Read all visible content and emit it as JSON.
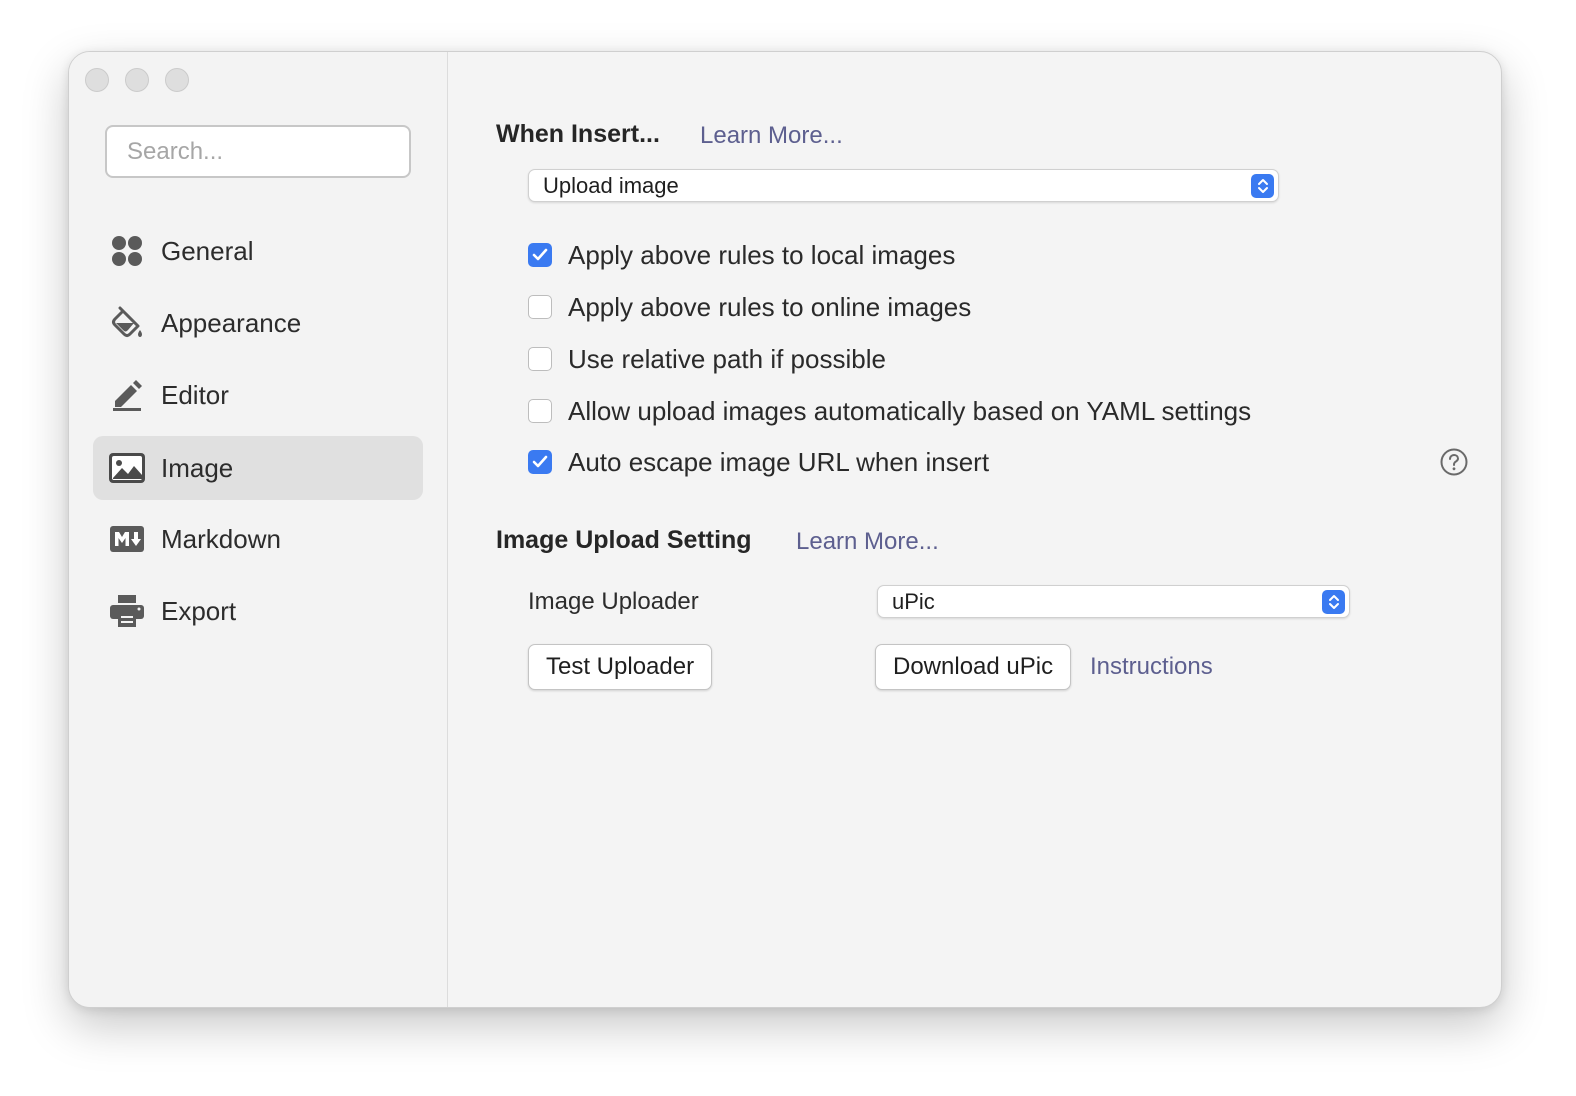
{
  "sidebar": {
    "search": {
      "placeholder": "Search..."
    },
    "items": [
      {
        "label": "General",
        "icon": "general-icon"
      },
      {
        "label": "Appearance",
        "icon": "paint-bucket-icon"
      },
      {
        "label": "Editor",
        "icon": "pencil-icon"
      },
      {
        "label": "Image",
        "icon": "image-icon",
        "active": true
      },
      {
        "label": "Markdown",
        "icon": "markdown-icon"
      },
      {
        "label": "Export",
        "icon": "printer-icon"
      }
    ]
  },
  "when_insert": {
    "title": "When Insert...",
    "learn_more": "Learn More...",
    "select_value": "Upload image",
    "options": [
      {
        "label": "Apply above rules to local images",
        "checked": true
      },
      {
        "label": "Apply above rules to online images",
        "checked": false
      },
      {
        "label": "Use relative path if possible",
        "checked": false
      },
      {
        "label": "Allow upload images automatically based on YAML settings",
        "checked": false
      },
      {
        "label": "Auto escape image URL when insert",
        "checked": true
      }
    ]
  },
  "upload_setting": {
    "title": "Image Upload Setting",
    "learn_more": "Learn More...",
    "uploader_label": "Image Uploader",
    "uploader_value": "uPic",
    "test_button": "Test Uploader",
    "download_button": "Download uPic",
    "instructions_link": "Instructions"
  },
  "colors": {
    "accent": "#3a7af1",
    "link": "#5d5f8f",
    "sidebar_active": "#e0e0e0",
    "window_bg": "#f4f4f4"
  }
}
